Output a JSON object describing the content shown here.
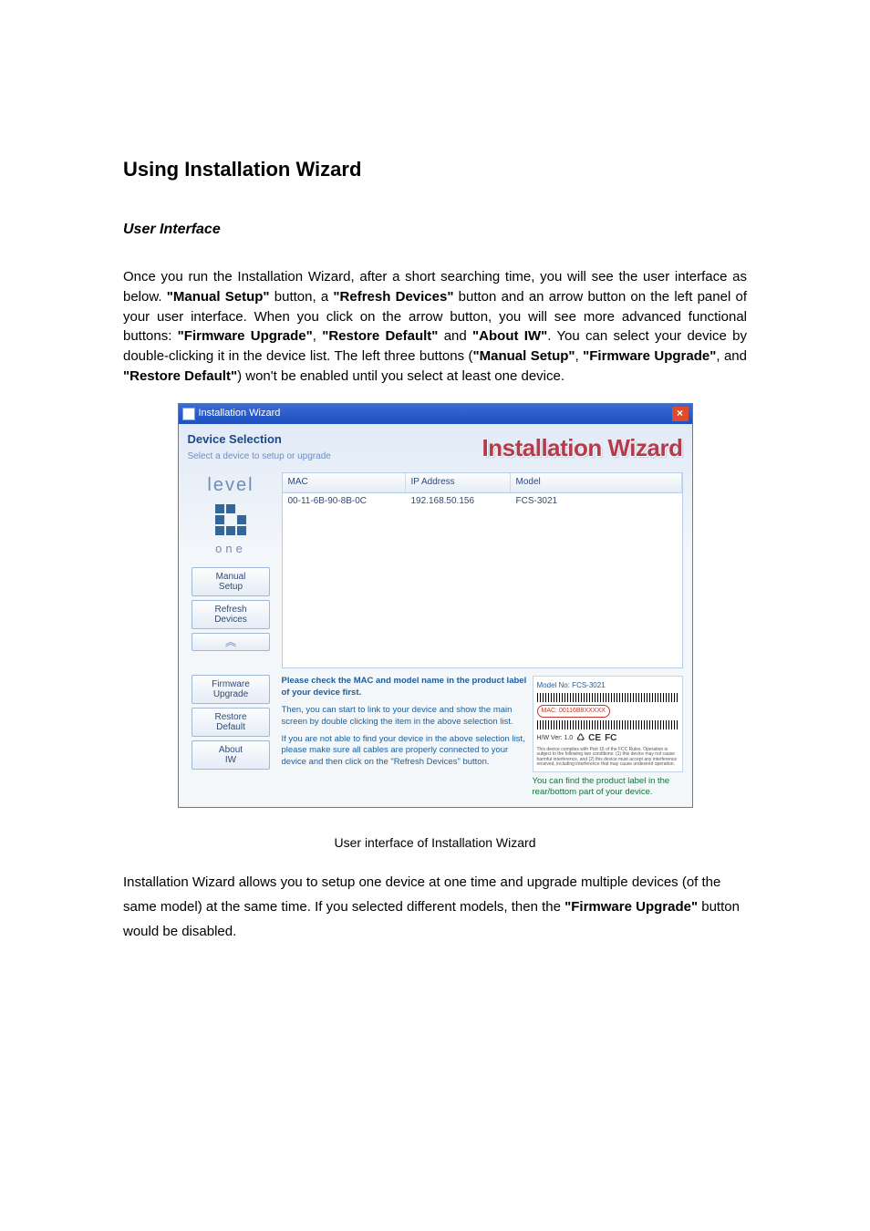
{
  "heading": "Using Installation Wizard",
  "subheading": "User Interface",
  "intro_parts": {
    "p1a": "Once you run the Installation Wizard, after a short searching time, you will see the user interface as below. ",
    "p1b": "\"Manual Setup\"",
    "p1c": " button, a ",
    "p1d": "\"Refresh Devices\"",
    "p1e": " button and an arrow button on the left panel of your user interface. When you click on the arrow button, you will see more advanced functional buttons: ",
    "p1f": "\"Firmware Upgrade\"",
    "p1g": ", ",
    "p1h": "\"Restore Default\"",
    "p1i": " and ",
    "p1j": "\"About IW\"",
    "p1k": ". You can select your device by double-clicking it in the device list. The left three buttons (",
    "p1l": "\"Manual Setup\"",
    "p1m": ", ",
    "p1n": "\"Firmware Upgrade\"",
    "p1o": ", and ",
    "p1p": "\"Restore Default\"",
    "p1q": ") won't be enabled until you select at least one device."
  },
  "wizard": {
    "title": "Installation Wizard",
    "section_title": "Device Selection",
    "section_subtitle": "Select a device to setup or upgrade",
    "brand_title": "Installation Wizard",
    "logo_top": "level",
    "logo_bottom": "one",
    "buttons": {
      "manual_setup": "Manual\nSetup",
      "refresh_devices": "Refresh\nDevices",
      "arrow": "︽",
      "firmware_upgrade": "Firmware\nUpgrade",
      "restore_default": "Restore\nDefault",
      "about_iw": "About\nIW"
    },
    "columns": {
      "mac": "MAC",
      "ip": "IP Address",
      "model": "Model"
    },
    "rows": [
      {
        "mac": "00-11-6B-90-8B-0C",
        "ip": "192.168.50.156",
        "model": "FCS-3021"
      }
    ],
    "hint1": "Please check the MAC and model name in the product label of your device first.",
    "hint2": "Then, you can start to link to your device and show the main screen by double clicking the item in the above selection list.",
    "hint3": "If you are not able to find your device in the above selection list, please make sure all cables are properly connected to your device and then click on the \"Refresh Devices\" button.",
    "label_model": "Model No: FCS-3021",
    "label_mac": "MAC: 00116B8XXXXX",
    "label_hw": "H/W Ver: 1.0",
    "label_hint": "You can find the product label in the rear/bottom part of your device."
  },
  "caption": "User interface of Installation Wizard",
  "outro": {
    "a": "Installation Wizard allows you to setup one device at one time and upgrade multiple devices (of the same model) at the same time. If you selected different models, then the ",
    "b": "\"Firmware Upgrade\"",
    "c": " button would be disabled."
  }
}
